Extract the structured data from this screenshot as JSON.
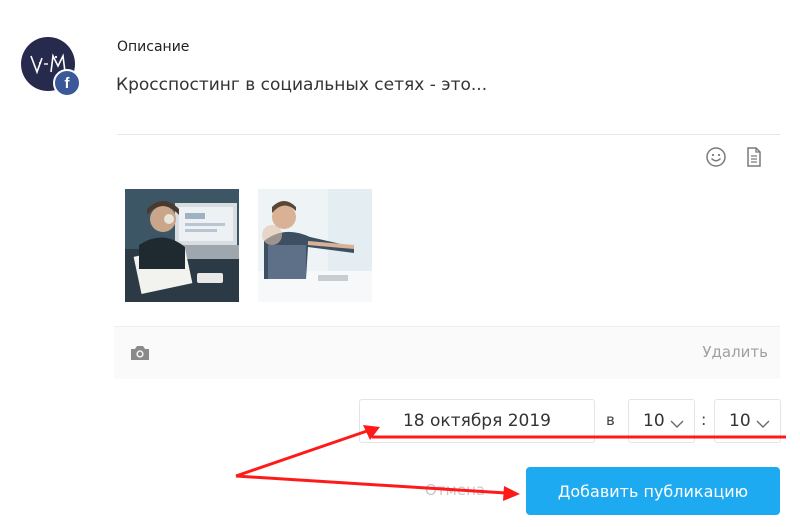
{
  "post": {
    "description_label": "Описание",
    "description_text": "Кросспостинг в социальных сетях - это...",
    "delete_label": "Удалить"
  },
  "account": {
    "network_badge": "f",
    "avatar_icon": "logo-icon"
  },
  "toolbar": {
    "emoji_icon": "smile-icon",
    "template_icon": "document-icon"
  },
  "images": [
    {
      "name": "woman-working-laptop-thumbnail"
    },
    {
      "name": "man-pointing-screen-thumbnail"
    }
  ],
  "schedule": {
    "date": "18 октября 2019",
    "at_label": "в",
    "hour": "10",
    "separator": ":",
    "minute": "10"
  },
  "actions": {
    "cancel_label": "Отмена",
    "submit_label": "Добавить публикацию"
  },
  "colors": {
    "accent": "#1eaaf1",
    "facebook": "#3b5998",
    "annotation": "#ff1a1a"
  }
}
